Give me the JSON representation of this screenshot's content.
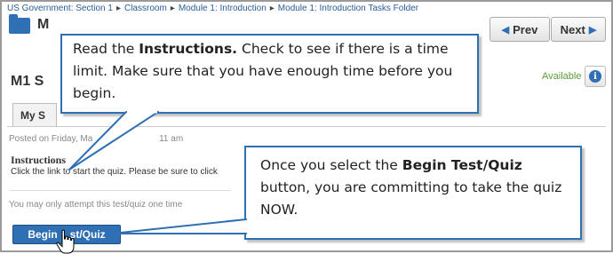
{
  "breadcrumb": {
    "items": [
      "US Government: Section 1",
      "Classroom",
      "Module 1: Introduction",
      "Module 1: Introduction Tasks Folder"
    ],
    "separator": "▸"
  },
  "header": {
    "folder_title": "M",
    "prev_label": "Prev",
    "next_label": "Next",
    "prev_icon": "triangle-left-icon",
    "next_icon": "triangle-right-icon"
  },
  "page": {
    "title": "M1 S",
    "availability": "Available",
    "info_icon": "info-icon",
    "tab_label": "My S",
    "posted": "Posted on Friday, Ma",
    "posted_tail": "11 am",
    "instructions_heading": "Instructions",
    "instructions_text": "Click the link to start the quiz. Please be sure to click",
    "attempt_text": "You may only attempt this test/quiz one time",
    "begin_button_left": "Begin",
    "begin_button_right": "st/Quiz"
  },
  "callouts": {
    "first": {
      "part1": "Read the ",
      "bold": "Instructions.",
      "part2": " Check to see if there is a time limit. Make sure that you have enough time before you begin."
    },
    "second": {
      "part1": "Once you select the ",
      "bold": "Begin Test/Quiz",
      "part2": " button, you are committing to take the quiz NOW."
    }
  },
  "colors": {
    "accent": "#2f6fb3",
    "available": "#5a9a3c",
    "link": "#2b5c9a"
  }
}
